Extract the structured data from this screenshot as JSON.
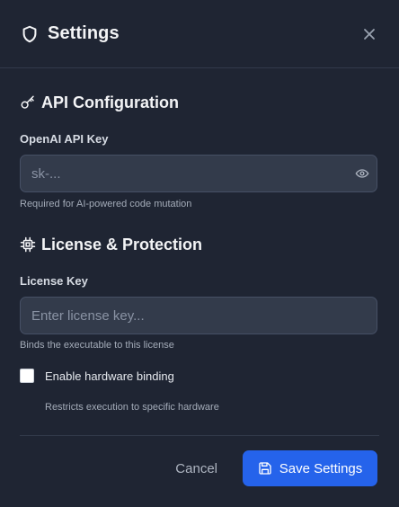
{
  "dialog": {
    "title": "Settings",
    "icons": {
      "title": "shield-icon",
      "close": "close-icon"
    }
  },
  "api_section": {
    "heading": "API Configuration",
    "icon": "key-icon",
    "field_label": "OpenAI API Key",
    "input_value": "",
    "input_placeholder": "sk-...",
    "toggle_icon": "eye-icon",
    "hint": "Required for AI-powered code mutation"
  },
  "license_section": {
    "heading": "License & Protection",
    "icon": "chip-icon",
    "field_label": "License Key",
    "input_value": "",
    "input_placeholder": "Enter license key...",
    "hint": "Binds the executable to this license",
    "checkbox_label": "Enable hardware binding",
    "checkbox_checked": false,
    "checkbox_hint": "Restricts execution to specific hardware"
  },
  "footer": {
    "cancel_label": "Cancel",
    "save_label": "Save Settings",
    "save_icon": "save-icon",
    "accent": "#2563eb"
  }
}
